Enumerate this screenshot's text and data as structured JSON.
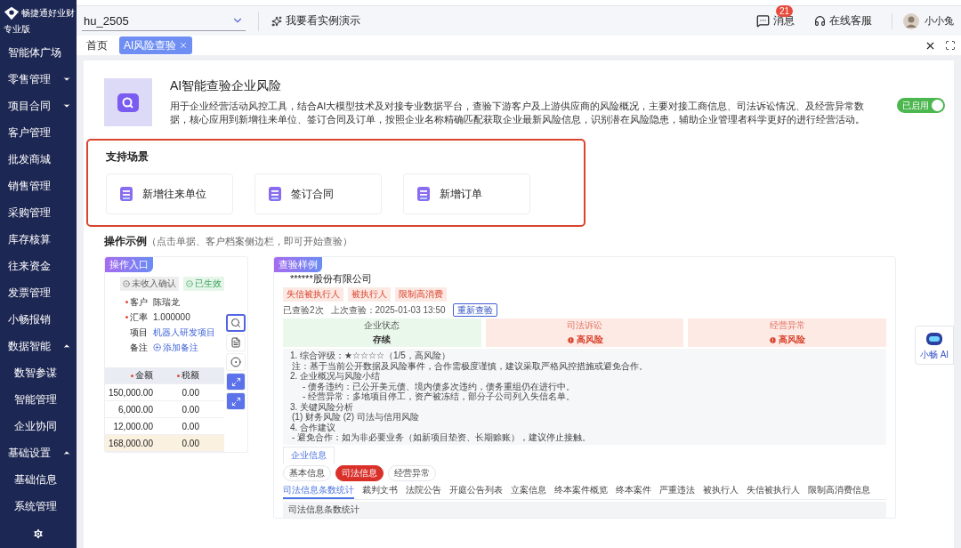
{
  "app": {
    "brand": "畅捷通好业财",
    "edition": "专业版"
  },
  "sidebar": {
    "items": [
      {
        "label": "智能体广场"
      },
      {
        "label": "零售管理",
        "expanded": false
      },
      {
        "label": "项目合同",
        "expanded": false
      },
      {
        "label": "客户管理"
      },
      {
        "label": "批发商城"
      },
      {
        "label": "销售管理"
      },
      {
        "label": "采购管理"
      },
      {
        "label": "库存核算"
      },
      {
        "label": "往来资金"
      },
      {
        "label": "发票管理"
      },
      {
        "label": "小畅报销"
      },
      {
        "label": "数据智能",
        "expanded": true,
        "children": [
          {
            "label": "数智参谋"
          },
          {
            "label": "智能管理"
          },
          {
            "label": "企业协同"
          }
        ]
      },
      {
        "label": "基础设置",
        "expanded": true,
        "children": [
          {
            "label": "基础信息"
          },
          {
            "label": "系统管理"
          }
        ]
      }
    ]
  },
  "topbar": {
    "account": "hu_2505",
    "demo_link": "我要看实例演示",
    "messages": {
      "label": "消息",
      "badge": "21"
    },
    "support": "在线客服",
    "user": "小小兔"
  },
  "tabs": [
    {
      "label": "首页",
      "selected": false,
      "closable": false
    },
    {
      "label": "AI风险查验",
      "selected": true,
      "closable": true
    }
  ],
  "feature": {
    "title": "AI智能查验企业风险",
    "description": "用于企业经营活动风控工具，结合AI大模型技术及对接专业数据平台，查验下游客户及上游供应商的风险概况，主要对接工商信息、司法诉讼情况、及经营异常数据，核心应用到新增往来单位、签订合同及订单，按照企业名称精确匹配获取企业最新风险信息，识别潜在风险隐患，辅助企业管理者科学更好的进行经营活动。",
    "enabled": true,
    "toggle_label": "已启用"
  },
  "scenarios": {
    "title": "支持场景",
    "items": [
      {
        "label": "新增往来单位"
      },
      {
        "label": "签订合同"
      },
      {
        "label": "新增订单"
      }
    ]
  },
  "examples": {
    "title": "操作示例",
    "hint": "（点击单据、客户档案侧边栏，即可开始查验）",
    "entry": {
      "badge": "操作入口",
      "status_tags": [
        {
          "label": "未收入确认",
          "kind": "pending"
        },
        {
          "label": "已生效",
          "kind": "active"
        }
      ],
      "fields": [
        {
          "label": "客户",
          "required": true,
          "value": "陈瑞龙",
          "kind": "text"
        },
        {
          "label": "汇率",
          "required": true,
          "value": "1.000000",
          "kind": "text"
        },
        {
          "label": "项目",
          "required": false,
          "value": "机器人研发项目",
          "kind": "link"
        },
        {
          "label": "备注",
          "required": false,
          "value": "添加备注",
          "kind": "add"
        }
      ],
      "columns": [
        {
          "label": "金额",
          "required": true
        },
        {
          "label": "税额",
          "required": true
        }
      ],
      "rows": [
        {
          "kind": "line",
          "cells": [
            "150,000.00",
            "0.00"
          ]
        },
        {
          "kind": "line",
          "cells": [
            "6,000.00",
            "0.00"
          ]
        },
        {
          "kind": "line",
          "cells": [
            "12,000.00",
            "0.00"
          ]
        },
        {
          "kind": "total",
          "cells": [
            "168,000.00",
            "0.00"
          ]
        }
      ],
      "tools": [
        {
          "kind": "ai",
          "selected": true
        },
        {
          "kind": "doc",
          "selected": false
        },
        {
          "kind": "circle",
          "selected": false
        },
        {
          "kind": "expand",
          "selected": false
        },
        {
          "kind": "expand",
          "selected": false
        }
      ]
    },
    "sample": {
      "badge": "查验样例",
      "company": "******股份有限公司",
      "risk_tags": [
        "失信被执行人",
        "被执行人",
        "限制高消费"
      ],
      "check_count": "已查验2次",
      "last_check": "上次查验：2025-01-03 13:50",
      "recheck_button": "重新查验",
      "status_cards": [
        {
          "label": "企业状态",
          "value": "存续",
          "kind": "normal"
        },
        {
          "label": "司法诉讼",
          "value": "高风险",
          "kind": "risk"
        },
        {
          "label": "经营异常",
          "value": "高风险",
          "kind": "risk"
        }
      ],
      "report": [
        {
          "kind": "heading",
          "text": "1. 综合评级：★☆☆☆☆（1/5，高风险）"
        },
        {
          "kind": "note",
          "text": "注：基于当前公开数据及风险事件，合作需极度谨慎，建议采取严格风控措施或避免合作。"
        },
        {
          "kind": "heading",
          "text": "2. 企业概况与风险小结"
        },
        {
          "kind": "bullet",
          "text": "- 债务违约：已公开美元债、境内债多次违约，债务重组仍在进行中。"
        },
        {
          "kind": "bullet",
          "text": "- 经营异常：多地项目停工，资产被冻结，部分子公司列入失信名单。"
        },
        {
          "kind": "heading",
          "text": "3. 关键风险分析"
        },
        {
          "kind": "note",
          "text": "(1) 财务风险 (2) 司法与信用风险"
        },
        {
          "kind": "heading",
          "text": "4. 合作建议"
        },
        {
          "kind": "note",
          "text": "- 避免合作：如为非必要业务（如新项目垫资、长期赊账），建议停止接触。"
        }
      ],
      "info_tab": "企业信息",
      "pills": [
        {
          "label": "基本信息",
          "selected": false
        },
        {
          "label": "司法信息",
          "selected": true
        },
        {
          "label": "经营异常",
          "selected": false
        }
      ],
      "subtabs": [
        {
          "label": "司法信息条数统计",
          "selected": true
        },
        {
          "label": "裁判文书",
          "selected": false
        },
        {
          "label": "法院公告",
          "selected": false
        },
        {
          "label": "开庭公告列表",
          "selected": false
        },
        {
          "label": "立案信息",
          "selected": false
        },
        {
          "label": "终本案件概览",
          "selected": false
        },
        {
          "label": "终本案件",
          "selected": false
        },
        {
          "label": "严重违法",
          "selected": false
        },
        {
          "label": "被执行人",
          "selected": false
        },
        {
          "label": "失信被执行人",
          "selected": false
        },
        {
          "label": "限制高消费信息",
          "selected": false
        }
      ],
      "section_title": "司法信息条数统计"
    }
  },
  "assistant": {
    "label": "小畅 AI"
  }
}
